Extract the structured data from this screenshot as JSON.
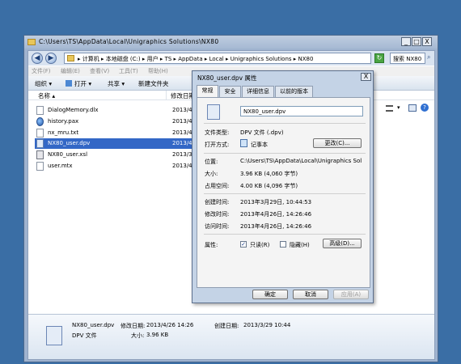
{
  "explorer": {
    "title": "C:\\Users\\TS\\AppData\\Local\\Unigraphics Solutions\\NX80",
    "window_buttons": {
      "minimize": "_",
      "maximize": "□",
      "close": "X"
    },
    "nav": {
      "back": "◀",
      "forward": "▶"
    },
    "address": "▸ 计算机 ▸ 本地磁盘 (C:) ▸ 用户 ▸ TS ▸ AppData ▸ Local ▸ Unigraphics Solutions ▸ NX80",
    "search_placeholder": "搜索 NX80",
    "menu": [
      "文件(F)",
      "编辑(E)",
      "查看(V)",
      "工具(T)",
      "帮助(H)"
    ],
    "toolbar": {
      "organize": "组织 ▾",
      "open": "打开 ▾",
      "share": "共享 ▾",
      "new_folder": "新建文件夹"
    },
    "columns": {
      "name": "名称",
      "sort_arrow": "▴",
      "modified": "修改日期"
    },
    "files": [
      {
        "name": "DialogMemory.dlx",
        "date": "2013/4/2",
        "icon": "file-icon"
      },
      {
        "name": "history.pax",
        "date": "2013/4/2",
        "icon": "web-file-icon"
      },
      {
        "name": "nx_mru.txt",
        "date": "2013/4/2",
        "icon": "text-file-icon"
      },
      {
        "name": "NX80_user.dpv",
        "date": "2013/4/2",
        "icon": "dpv-file-icon",
        "selected": true
      },
      {
        "name": "NX80_user.xsl",
        "date": "2013/3/2",
        "icon": "xsl-file-icon"
      },
      {
        "name": "user.mtx",
        "date": "2013/4/2",
        "icon": "file-icon"
      }
    ],
    "details": {
      "filename": "NX80_user.dpv",
      "modified_label": "修改日期:",
      "modified": "2013/4/26 14:26",
      "created_label": "创建日期:",
      "created": "2013/3/29 10:44",
      "type": "DPV 文件",
      "size_label": "大小:",
      "size": "3.96 KB"
    }
  },
  "dialog": {
    "title": "NX80_user.dpv 属性",
    "close": "X",
    "tabs": [
      "常规",
      "安全",
      "详细信息",
      "以前的版本"
    ],
    "name_value": "NX80_user.dpv",
    "type_label": "文件类型:",
    "type_value": "DPV 文件 (.dpv)",
    "opens_label": "打开方式:",
    "opens_value": "记事本",
    "change_button": "更改(C)...",
    "location_label": "位置:",
    "location_value": "C:\\Users\\TS\\AppData\\Local\\Unigraphics Sol",
    "size_label": "大小:",
    "size_value": "3.96 KB (4,060 字节)",
    "disk_label": "占用空间:",
    "disk_value": "4.00 KB (4,096 字节)",
    "created_label": "创建时间:",
    "created_value": "2013年3月29日, 10:44:53",
    "modified_label": "修改时间:",
    "modified_value": "2013年4月26日, 14:26:46",
    "accessed_label": "访问时间:",
    "accessed_value": "2013年4月26日, 14:26:46",
    "attr_label": "属性:",
    "readonly_label": "只读(R)",
    "readonly_checked": "✓",
    "hidden_label": "隐藏(H)",
    "advanced_button": "高级(D)...",
    "ok": "确定",
    "cancel": "取消",
    "apply": "应用(A)"
  }
}
